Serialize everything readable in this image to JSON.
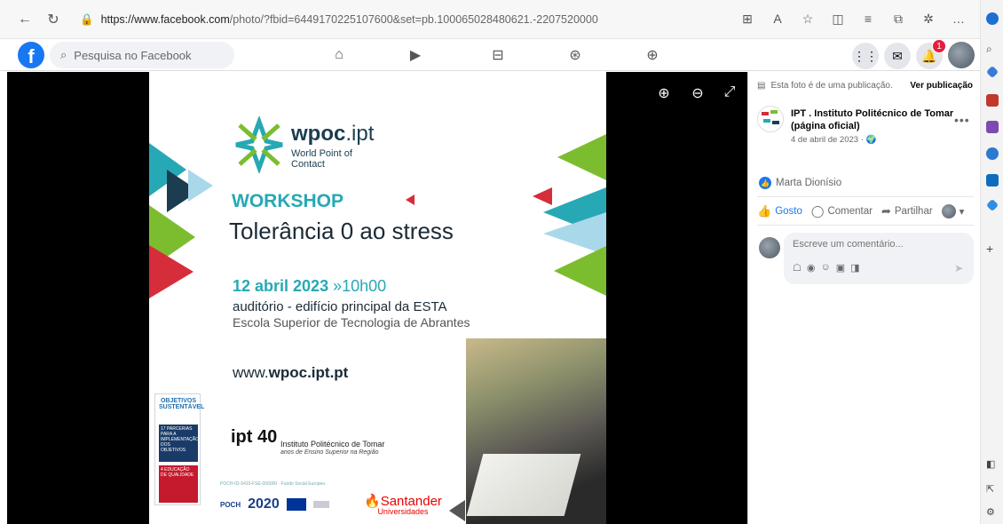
{
  "browser": {
    "url_host": "https://www.facebook.com",
    "url_path": "/photo/?fbid=6449170225107600&set=pb.100065028480621.-2207520000",
    "icons": [
      "apps-icon",
      "read-aloud-icon",
      "favorite-icon",
      "split-screen-icon",
      "favorites-list-icon",
      "collections-icon",
      "extensions-icon",
      "more-icon"
    ]
  },
  "fb": {
    "search_placeholder": "Pesquisa no Facebook",
    "notification_count": "1",
    "brand_color": "#1877f2"
  },
  "poster": {
    "brand_bold": "wpoc",
    "brand_rest": ".ipt",
    "brand_sub": "World Point of Contact",
    "workshop": "WORKSHOP",
    "title": "Tolerância 0 ao stress",
    "date_bold": "12 abril 2023",
    "time": " »10h00",
    "place": "auditório - edifício principal da ESTA",
    "school": "Escola Superior de Tecnologia de Abrantes",
    "url_plain": "www.",
    "url_bold": "wpoc.ipt.pt",
    "sdg_title": "OBJETIVOS SUSTENTÁVEL",
    "sdg17": "17 PARCERIAS PARA A IMPLEMENTAÇÃO DOS OBJETIVOS",
    "sdg4": "4 EDUCAÇÃO DE QUALIDADE",
    "ipt_mark": "ipt 40",
    "ipt_name": "Instituto Politécnico de Tomar",
    "ipt_sub": "anos de Ensino Superior na Região",
    "funding_line": "POCH-02-5410-FSE-000000 · Fundo Social Europeu",
    "portugal2020": "2020",
    "santander": "Santander",
    "santander_sub": "Universidades"
  },
  "panel": {
    "from_publication": "Esta foto é de uma publicação.",
    "see_publication": "Ver publicação",
    "page_name": "IPT . Instituto Politécnico de Tomar (página oficial)",
    "post_date": "4 de abril de 2023 · 🌍",
    "reactor": "Marta Dionísio",
    "like_label": "Gosto",
    "comment_label": "Comentar",
    "share_label": "Partilhar",
    "comment_placeholder": "Escreve um comentário..."
  }
}
